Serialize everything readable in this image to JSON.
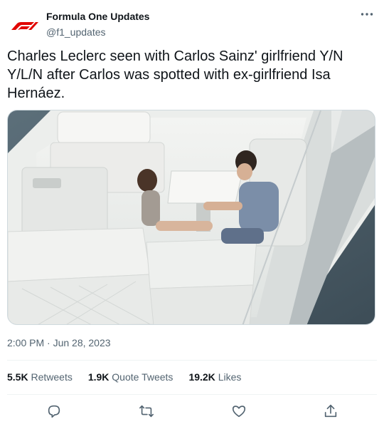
{
  "author": {
    "name": "Formula One Updates",
    "handle": "@f1_updates",
    "avatar_icon": "f1-logo-icon",
    "brand_color": "#e10600"
  },
  "more_icon": "more-horizontal-icon",
  "tweet": {
    "text": "Charles Leclerc seen with Carlos Sainz' girlfriend Y/N Y/L/N after Carlos was spotted with ex-girlfriend Isa Hernáez.",
    "timestamp": "2:00 PM · Jun 28, 2023"
  },
  "media": {
    "kind": "photo",
    "subject": "two people seated on a white boat deck"
  },
  "stats": {
    "retweets_count": "5.5K",
    "retweets_label": "Retweets",
    "quotes_count": "1.9K",
    "quotes_label": "Quote Tweets",
    "likes_count": "19.2K",
    "likes_label": "Likes"
  },
  "actions": [
    {
      "name": "reply",
      "icon": "reply-icon"
    },
    {
      "name": "retweet",
      "icon": "retweet-icon"
    },
    {
      "name": "like",
      "icon": "heart-icon"
    },
    {
      "name": "share",
      "icon": "share-icon"
    }
  ],
  "colors": {
    "text": "#0f1419",
    "secondary": "#536471",
    "divider": "#eff3f4"
  }
}
